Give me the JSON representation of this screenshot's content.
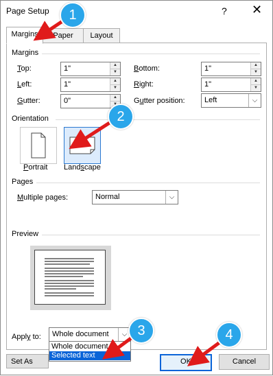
{
  "window": {
    "title": "Page Setup",
    "help": "?",
    "close": "✕"
  },
  "tabs": [
    {
      "label": "Margins",
      "active": true
    },
    {
      "label": "Paper",
      "active": false
    },
    {
      "label": "Layout",
      "active": false
    }
  ],
  "margins": {
    "heading": "Margins",
    "top": {
      "label": "Top:",
      "accel": "T",
      "rest": "op:",
      "value": "1\""
    },
    "bottom": {
      "label": "Bottom:",
      "accel": "B",
      "rest": "ottom:",
      "value": "1\""
    },
    "left": {
      "label": "Left:",
      "accel": "L",
      "rest": "eft:",
      "value": "1\""
    },
    "right": {
      "label": "Right:",
      "accel": "R",
      "rest": "ight:",
      "value": "1\""
    },
    "gutter": {
      "label": "Gutter:",
      "accel": "G",
      "rest": "utter:",
      "value": "0\""
    },
    "gutter_position": {
      "label": "Gutter position:",
      "pre": "G",
      "accel": "u",
      "rest": "tter position:",
      "value": "Left"
    }
  },
  "orientation": {
    "heading": "Orientation",
    "portrait": {
      "pre": "",
      "accel": "P",
      "rest": "ortrait"
    },
    "landscape": {
      "pre": "Land",
      "accel": "s",
      "rest": "cape"
    },
    "selected": "landscape"
  },
  "pages": {
    "heading": "Pages",
    "multiple_pages": {
      "pre": "",
      "accel": "M",
      "rest": "ultiple pages:",
      "value": "Normal"
    }
  },
  "preview": {
    "heading": "Preview"
  },
  "apply_to": {
    "label_pre": "Appl",
    "accel": "y",
    "label_rest": " to:",
    "value": "Whole document",
    "options": [
      "Whole document",
      "Selected text"
    ],
    "highlighted": "Selected text"
  },
  "buttons": {
    "set_default": "Set As Defa",
    "ok": "OK",
    "cancel": "Cancel"
  },
  "callouts": [
    "1",
    "2",
    "3",
    "4"
  ],
  "colors": {
    "callout": "#2aa6ea",
    "arrow": "#e01b1b",
    "selection": "#0a64d8"
  }
}
